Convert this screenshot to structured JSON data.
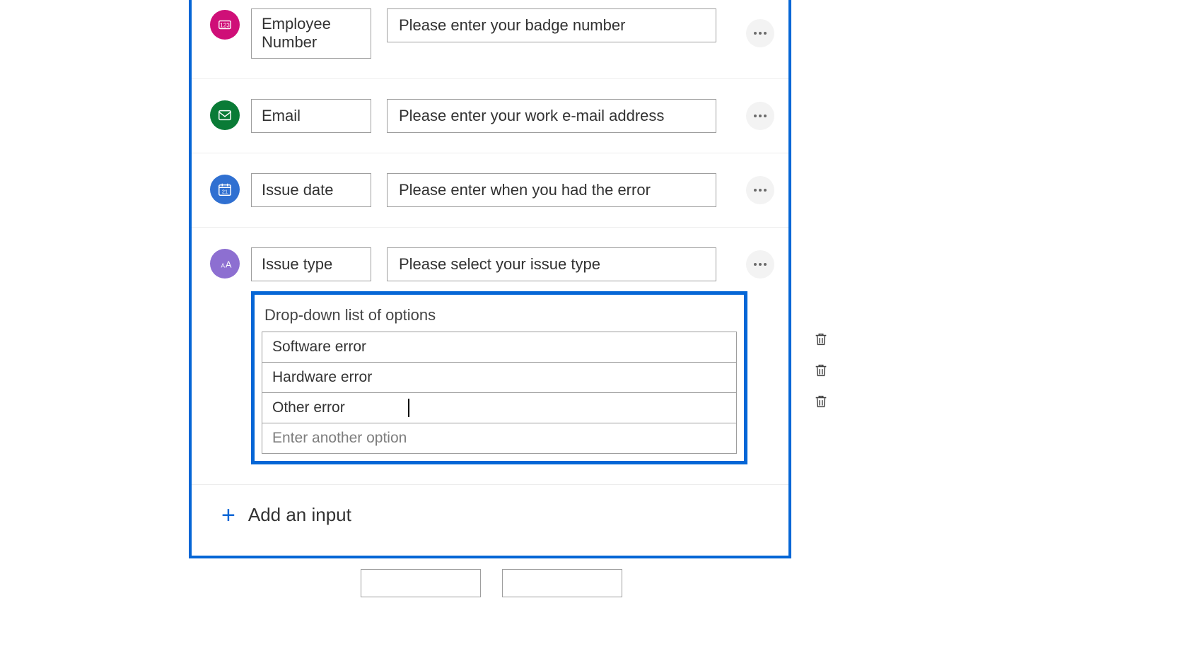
{
  "inputs": {
    "employee": {
      "name": "Employee Number",
      "prompt": "Please enter your badge number",
      "icon_name": "number-icon"
    },
    "email": {
      "name": "Email",
      "prompt": "Please enter your work e-mail address",
      "icon_name": "mail-icon"
    },
    "date": {
      "name": "Issue date",
      "prompt": "Please enter when you had the error",
      "icon_name": "calendar-icon"
    },
    "dropdown": {
      "name": "Issue type",
      "prompt": "Please select your issue type",
      "icon_name": "text-type-icon",
      "panel_title": "Drop-down list of options",
      "options": {
        "0": "Software error",
        "1": "Hardware error",
        "2": "Other error"
      },
      "new_option_placeholder": "Enter another option"
    }
  },
  "add_input_label": "Add an input"
}
